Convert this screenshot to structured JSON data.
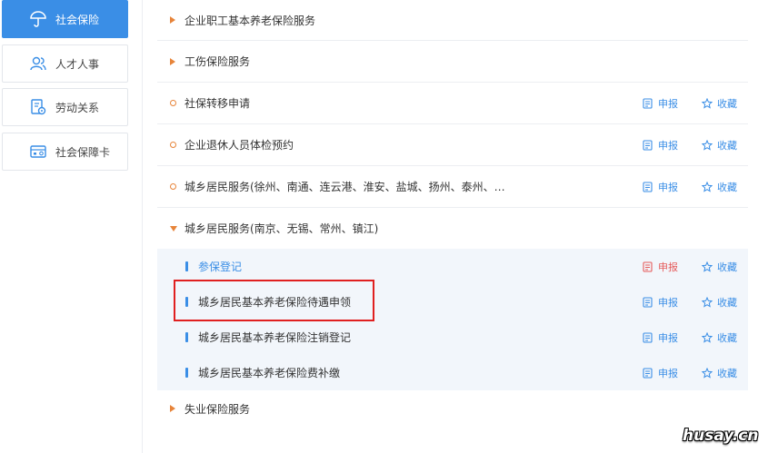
{
  "sidebar": {
    "items": [
      {
        "label": "社会保险",
        "icon": "umbrella-icon",
        "active": true
      },
      {
        "label": "人才人事",
        "icon": "people-icon",
        "active": false
      },
      {
        "label": "劳动关系",
        "icon": "document-gear-icon",
        "active": false
      },
      {
        "label": "社会保障卡",
        "icon": "card-icon",
        "active": false
      }
    ]
  },
  "services": {
    "apply_label": "申报",
    "favorite_label": "收藏",
    "items": [
      {
        "label": "企业职工基本养老保险服务",
        "marker": "collapsed"
      },
      {
        "label": "工伤保险服务",
        "marker": "collapsed"
      },
      {
        "label": "社保转移申请",
        "marker": "item"
      },
      {
        "label": "企业退休人员体检预约",
        "marker": "item"
      },
      {
        "label": "城乡居民服务(徐州、南通、连云港、淮安、盐城、扬州、泰州、…",
        "marker": "item"
      },
      {
        "label": "城乡居民服务(南京、无锡、常州、镇江)",
        "marker": "expanded"
      },
      {
        "label": "失业保险服务",
        "marker": "collapsed"
      }
    ],
    "subitems": [
      {
        "label": "参保登记"
      },
      {
        "label": "城乡居民基本养老保险待遇申领"
      },
      {
        "label": "城乡居民基本养老保险注销登记"
      },
      {
        "label": "城乡居民基本养老保险费补缴"
      }
    ]
  },
  "colors": {
    "accent": "#3a8ee6",
    "marker": "#e7843a",
    "highlight": "#e02020",
    "apply_alert": "#e55a5a"
  },
  "watermark": "husay.cn"
}
